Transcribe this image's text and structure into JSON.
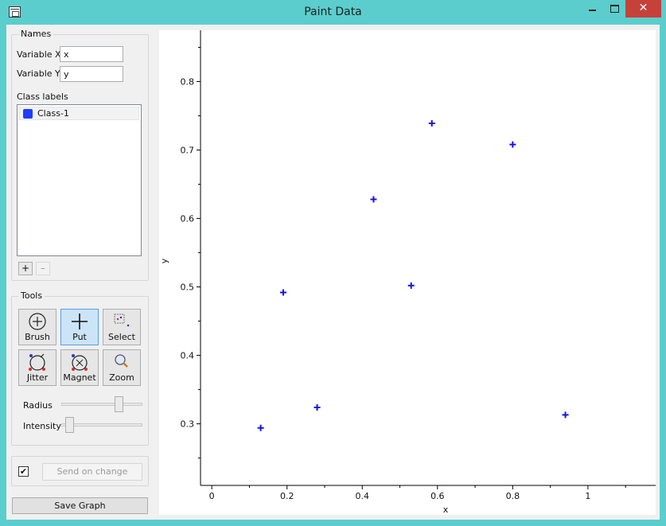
{
  "window": {
    "title": "Paint Data"
  },
  "names": {
    "group_title": "Names",
    "variable_x_label": "Variable X",
    "variable_x_value": "x",
    "variable_y_label": "Variable Y",
    "variable_y_value": "y",
    "class_labels_title": "Class labels",
    "classes": [
      {
        "label": "Class-1",
        "color": "#1f3dff"
      }
    ],
    "add_label": "+",
    "remove_label": "–"
  },
  "tools": {
    "group_title": "Tools",
    "buttons": [
      {
        "label": "Brush",
        "icon": "brush-icon",
        "active": false
      },
      {
        "label": "Put",
        "icon": "put-icon",
        "active": true
      },
      {
        "label": "Select",
        "icon": "select-icon",
        "active": false
      },
      {
        "label": "Jitter",
        "icon": "jitter-icon",
        "active": false
      },
      {
        "label": "Magnet",
        "icon": "magnet-icon",
        "active": false
      },
      {
        "label": "Zoom",
        "icon": "zoom-icon",
        "active": false
      }
    ],
    "radius_label": "Radius",
    "radius_value": 0.9,
    "intensity_label": "Intensity",
    "intensity_value": 0.05
  },
  "commit": {
    "send_on_change_checked": true,
    "check_mark": "✔",
    "send_on_change_label": "Send on change"
  },
  "save_graph_label": "Save Graph",
  "chart_data": {
    "type": "scatter",
    "xlabel": "x",
    "ylabel": "y",
    "xlim": [
      -0.03,
      1.18
    ],
    "ylim": [
      0.21,
      0.875
    ],
    "xticks": [
      0,
      0.2,
      0.4,
      0.6,
      0.8,
      1
    ],
    "xtick_labels": [
      "0",
      "0.2",
      "0.4",
      "0.6",
      "0.8",
      "1"
    ],
    "yticks": [
      0.3,
      0.4,
      0.5,
      0.6,
      0.7,
      0.8
    ],
    "ytick_labels": [
      "0.3",
      "0.4",
      "0.5",
      "0.6",
      "0.7",
      "0.8"
    ],
    "marker": "+",
    "color": "#1414e6",
    "series": [
      {
        "points": [
          {
            "x": 0.13,
            "y": 0.294
          },
          {
            "x": 0.19,
            "y": 0.492
          },
          {
            "x": 0.28,
            "y": 0.324
          },
          {
            "x": 0.43,
            "y": 0.628
          },
          {
            "x": 0.53,
            "y": 0.502
          },
          {
            "x": 0.585,
            "y": 0.739
          },
          {
            "x": 0.8,
            "y": 0.708
          },
          {
            "x": 0.94,
            "y": 0.313
          }
        ]
      }
    ]
  }
}
